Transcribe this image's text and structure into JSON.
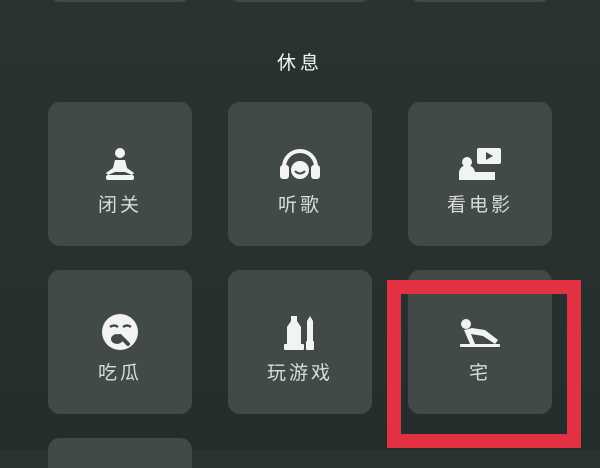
{
  "section": {
    "title": "休息"
  },
  "tiles": [
    {
      "label": "闭关",
      "icon": "meditation-icon"
    },
    {
      "label": "听歌",
      "icon": "headphones-icon"
    },
    {
      "label": "看电影",
      "icon": "movie-watching-icon"
    },
    {
      "label": "吃瓜",
      "icon": "eating-melon-face-icon"
    },
    {
      "label": "玩游戏",
      "icon": "game-pieces-icon"
    },
    {
      "label": "宅",
      "icon": "lounging-person-icon"
    }
  ],
  "colors": {
    "background": "#283130",
    "tile": "#424a47",
    "highlight": "#e23142",
    "text": "#e9ece9"
  }
}
